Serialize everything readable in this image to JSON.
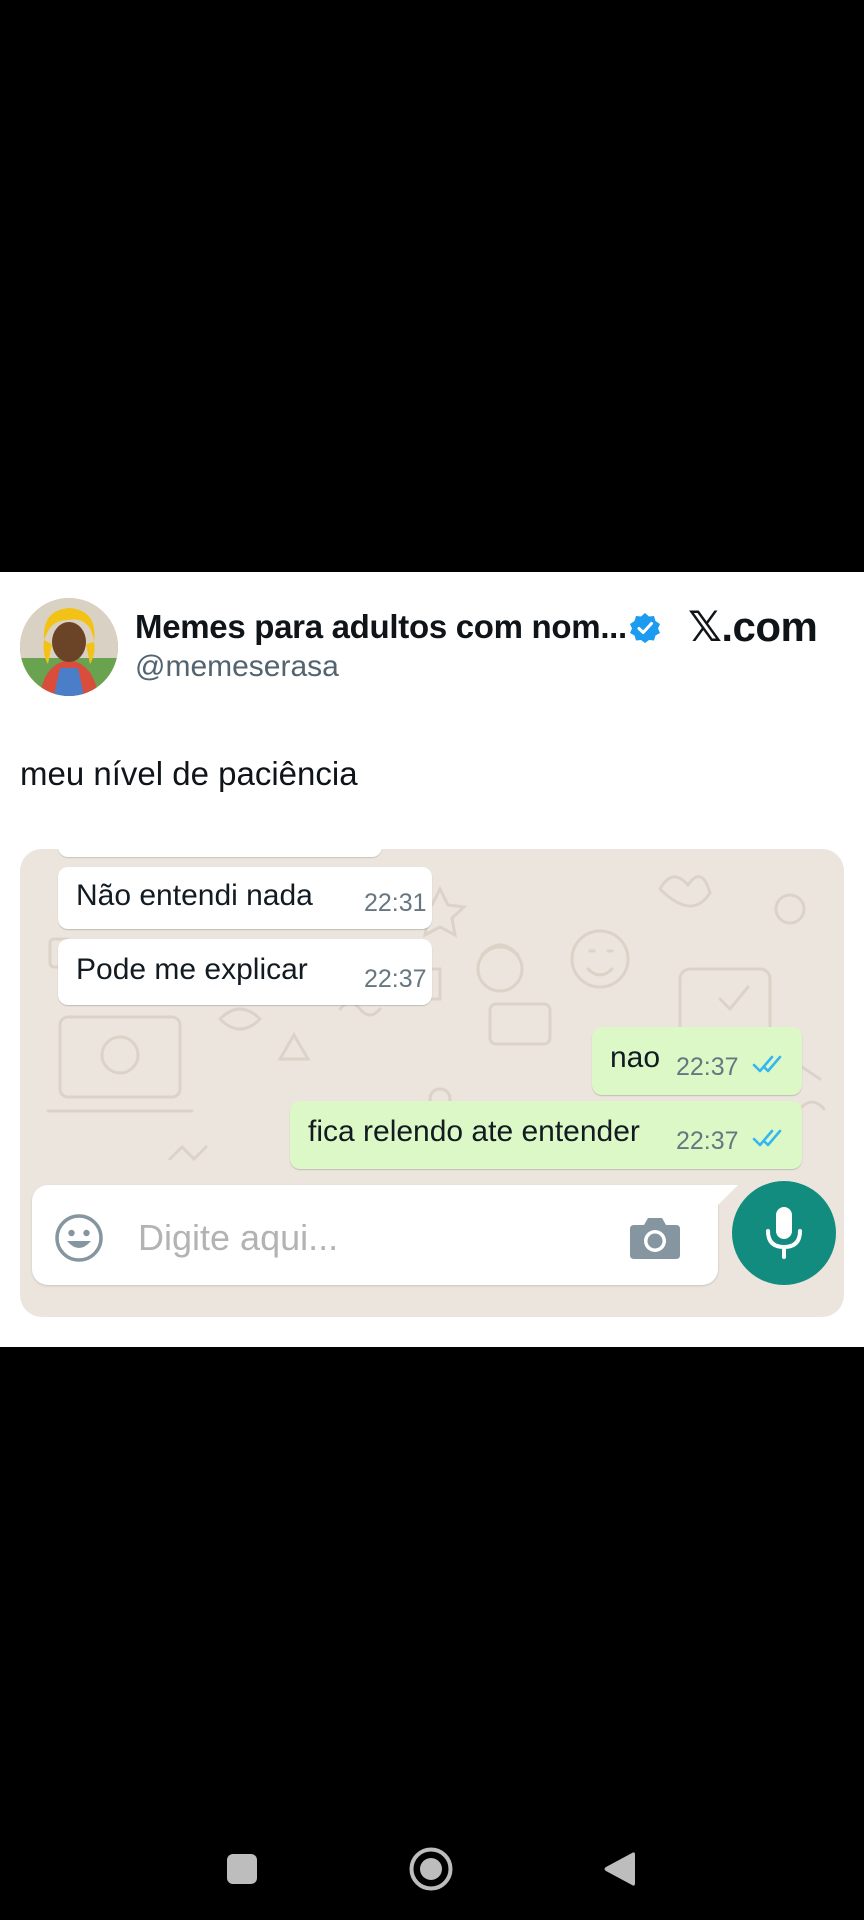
{
  "tweet": {
    "author_name": "Memes para adultos com nom...",
    "handle": "@memeserasa",
    "brand_x": "𝕏",
    "brand_suffix": ".com",
    "text": "meu nível de paciência"
  },
  "chat": {
    "messages": [
      {
        "direction": "incoming",
        "text": "Não entendi nada",
        "time": "22:31"
      },
      {
        "direction": "incoming",
        "text": "Pode me explicar",
        "time": "22:37"
      },
      {
        "direction": "outgoing",
        "text": "nao",
        "time": "22:37",
        "status": "read"
      },
      {
        "direction": "outgoing",
        "text": "fica relendo ate entender",
        "time": "22:37",
        "status": "read"
      }
    ],
    "input_placeholder": "Digite aqui...",
    "icons": [
      "emoji-icon",
      "camera-icon",
      "mic-icon"
    ]
  },
  "colors": {
    "chat_background": "#ece5dd",
    "incoming_bubble": "#ffffff",
    "outgoing_bubble": "#dcf8c6",
    "read_ticks": "#34b7f1",
    "mic_button": "#128c7e",
    "verified_badge": "#1d9bf0"
  },
  "system_nav": {
    "icons": [
      "recents-icon",
      "home-icon",
      "back-icon"
    ]
  }
}
